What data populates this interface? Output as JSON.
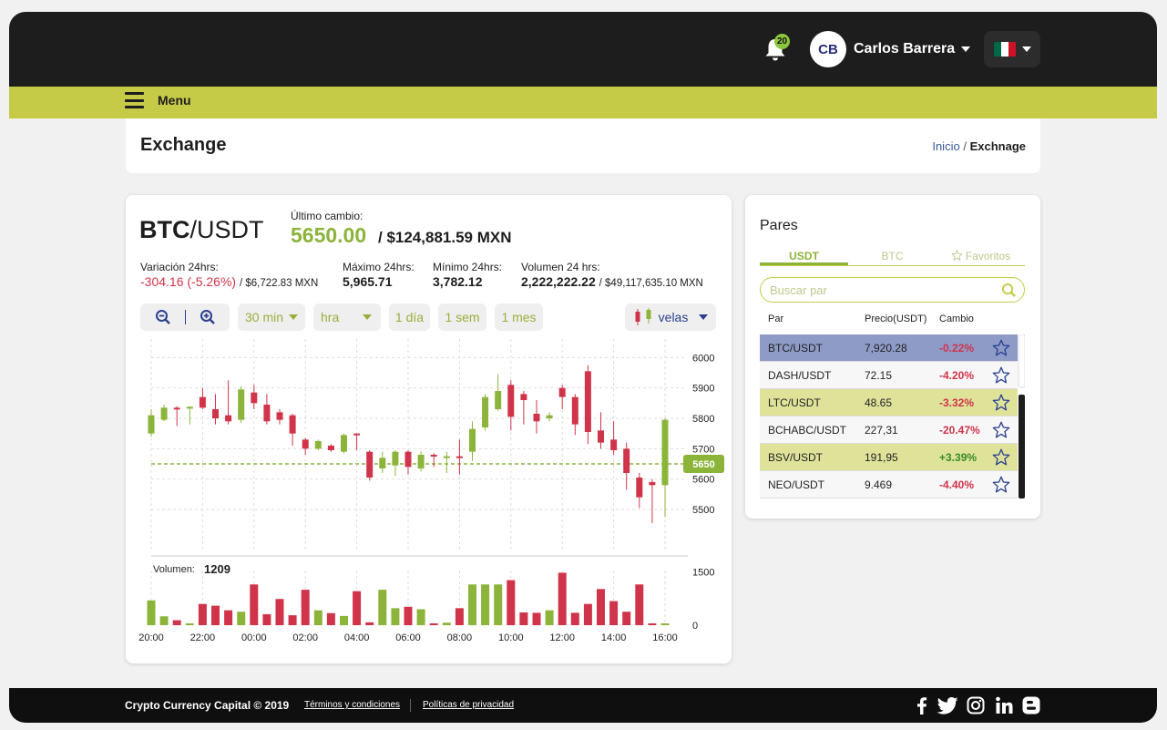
{
  "header": {
    "notifications_count": "20",
    "user_initials": "CB",
    "user_name": "Carlos Barrera",
    "flag_colors": [
      "#006847",
      "#ffffff",
      "#ce1126"
    ]
  },
  "menu": {
    "label": "Menu"
  },
  "page": {
    "title": "Exchange",
    "breadcrumb": {
      "home": "Inicio",
      "separator": "/",
      "current": "Exchnage"
    }
  },
  "pair": {
    "base": "BTC",
    "quote": "/USDT",
    "last_change_label": "Último cambio:",
    "last_price": "5650.00",
    "last_price_mxn": "/ $124,881.59 MXN",
    "stats": {
      "variation_label": "Variación 24hrs:",
      "variation_value": "-304.16 (-5.26%)",
      "variation_mxn": "/ $6,722.83 MXN",
      "max_label": "Máximo 24hrs:",
      "max_value": "5,965.71",
      "min_label": "Mínimo 24hrs:",
      "min_value": "3,782.12",
      "volume_label": "Volumen 24 hrs:",
      "volume_value": "2,222,222.22",
      "volume_mxn": "/ $49,117,635.10 MXN"
    }
  },
  "toolbar": {
    "interval": "30 min",
    "unit": "hra",
    "range_day": "1 día",
    "range_week": "1 sem",
    "range_month": "1 mes",
    "chart_style": "velas"
  },
  "chart_data": {
    "type": "candlestick",
    "x_ticks": [
      "20:00",
      "22:00",
      "00:00",
      "02:00",
      "04:00",
      "06:00",
      "08:00",
      "10:00",
      "12:00",
      "14:00",
      "16:00"
    ],
    "y_ticks": [
      6000,
      5900,
      5800,
      5700,
      5600,
      5500
    ],
    "ylim": [
      5440,
      6010
    ],
    "current_price": 5650,
    "current_price_label": "5650",
    "volume_label": "Volumen:",
    "volume_value": "1209",
    "volume_ticks": [
      1500,
      0
    ],
    "volume_max": 1800,
    "colors": {
      "up": "#8cb43a",
      "down": "#d0344a"
    },
    "candles": [
      {
        "o": 5750,
        "c": 5810,
        "h": 5830,
        "l": 5740
      },
      {
        "o": 5795,
        "c": 5835,
        "h": 5845,
        "l": 5790
      },
      {
        "o": 5835,
        "c": 5830,
        "h": 5840,
        "l": 5775
      },
      {
        "o": 5835,
        "c": 5838,
        "h": 5840,
        "l": 5780
      },
      {
        "o": 5870,
        "c": 5835,
        "h": 5900,
        "l": 5830
      },
      {
        "o": 5830,
        "c": 5800,
        "h": 5880,
        "l": 5780
      },
      {
        "o": 5810,
        "c": 5790,
        "h": 5925,
        "l": 5780
      },
      {
        "o": 5795,
        "c": 5895,
        "h": 5905,
        "l": 5785
      },
      {
        "o": 5885,
        "c": 5850,
        "h": 5910,
        "l": 5830
      },
      {
        "o": 5845,
        "c": 5790,
        "h": 5880,
        "l": 5780
      },
      {
        "o": 5820,
        "c": 5795,
        "h": 5830,
        "l": 5780
      },
      {
        "o": 5810,
        "c": 5750,
        "h": 5815,
        "l": 5710
      },
      {
        "o": 5730,
        "c": 5700,
        "h": 5735,
        "l": 5680
      },
      {
        "o": 5700,
        "c": 5725,
        "h": 5730,
        "l": 5695
      },
      {
        "o": 5710,
        "c": 5695,
        "h": 5715,
        "l": 5690
      },
      {
        "o": 5690,
        "c": 5745,
        "h": 5750,
        "l": 5685
      },
      {
        "o": 5750,
        "c": 5745,
        "h": 5750,
        "l": 5695
      },
      {
        "o": 5690,
        "c": 5605,
        "h": 5695,
        "l": 5595
      },
      {
        "o": 5635,
        "c": 5670,
        "h": 5690,
        "l": 5620
      },
      {
        "o": 5645,
        "c": 5690,
        "h": 5695,
        "l": 5610
      },
      {
        "o": 5690,
        "c": 5640,
        "h": 5695,
        "l": 5615
      },
      {
        "o": 5635,
        "c": 5680,
        "h": 5690,
        "l": 5625
      },
      {
        "o": 5680,
        "c": 5675,
        "h": 5685,
        "l": 5640
      },
      {
        "o": 5675,
        "c": 5675,
        "h": 5690,
        "l": 5620
      },
      {
        "o": 5675,
        "c": 5673,
        "h": 5730,
        "l": 5615
      },
      {
        "o": 5690,
        "c": 5765,
        "h": 5790,
        "l": 5660
      },
      {
        "o": 5770,
        "c": 5870,
        "h": 5880,
        "l": 5760
      },
      {
        "o": 5830,
        "c": 5890,
        "h": 5945,
        "l": 5825
      },
      {
        "o": 5910,
        "c": 5805,
        "h": 5925,
        "l": 5760
      },
      {
        "o": 5880,
        "c": 5860,
        "h": 5890,
        "l": 5780
      },
      {
        "o": 5815,
        "c": 5790,
        "h": 5860,
        "l": 5750
      },
      {
        "o": 5800,
        "c": 5810,
        "h": 5820,
        "l": 5790
      },
      {
        "o": 5900,
        "c": 5870,
        "h": 5910,
        "l": 5830
      },
      {
        "o": 5870,
        "c": 5780,
        "h": 5880,
        "l": 5745
      },
      {
        "o": 5955,
        "c": 5755,
        "h": 5975,
        "l": 5715
      },
      {
        "o": 5760,
        "c": 5720,
        "h": 5820,
        "l": 5700
      },
      {
        "o": 5730,
        "c": 5695,
        "h": 5790,
        "l": 5680
      },
      {
        "o": 5700,
        "c": 5620,
        "h": 5720,
        "l": 5565
      },
      {
        "o": 5605,
        "c": 5540,
        "h": 5620,
        "l": 5505
      },
      {
        "o": 5590,
        "c": 5580,
        "h": 5600,
        "l": 5455
      },
      {
        "o": 5580,
        "c": 5795,
        "h": 5800,
        "l": 5475
      }
    ],
    "volumes": [
      700,
      250,
      140,
      0,
      600,
      550,
      420,
      380,
      1150,
      310,
      740,
      280,
      1000,
      420,
      340,
      260,
      960,
      80,
      1000,
      480,
      520,
      450,
      40,
      70,
      480,
      1150,
      1150,
      1150,
      1270,
      360,
      350,
      420,
      1480,
      350,
      600,
      1020,
      680,
      380,
      1150,
      0,
      0
    ]
  },
  "pairs_panel": {
    "title": "Pares",
    "tabs": [
      "USDT",
      "BTC",
      "Favoritos"
    ],
    "search_placeholder": "Buscar par",
    "headers": {
      "pair": "Par",
      "price": "Precio(USDT)",
      "change": "Cambio"
    },
    "rows": [
      {
        "pair": "BTC/USDT",
        "price": "7,920.28",
        "change": "-0.22%",
        "bg": "#8e9bc7",
        "chg_color": "#d0344a"
      },
      {
        "pair": "DASH/USDT",
        "price": "72.15",
        "change": "-4.20%",
        "bg": "#f7f7f7",
        "chg_color": "#d0344a"
      },
      {
        "pair": "LTC/USDT",
        "price": "48.65",
        "change": "-3.32%",
        "bg": "#dfe39a",
        "chg_color": "#d0344a"
      },
      {
        "pair": "BCHABC/USDT",
        "price": "227,31",
        "change": "-20.47%",
        "bg": "#f7f7f7",
        "chg_color": "#d0344a"
      },
      {
        "pair": "BSV/USDT",
        "price": "191,95",
        "change": "+3.39%",
        "bg": "#dfe39a",
        "chg_color": "#3a8a2a"
      },
      {
        "pair": "NEO/USDT",
        "price": "9.469",
        "change": "-4.40%",
        "bg": "#f7f7f7",
        "chg_color": "#d0344a"
      }
    ]
  },
  "footer": {
    "copyright": "Crypto Currency Capital © 2019",
    "terms": "Términos y condiciones",
    "privacy": "Políticas de privacidad"
  },
  "icons": {
    "bell": "bell-icon",
    "zoom_out": "zoom-out-icon",
    "zoom_in": "zoom-in-icon",
    "search": "search-icon",
    "star": "star-icon",
    "social": [
      "facebook-icon",
      "twitter-icon",
      "instagram-icon",
      "linkedin-icon",
      "blogger-icon"
    ]
  }
}
